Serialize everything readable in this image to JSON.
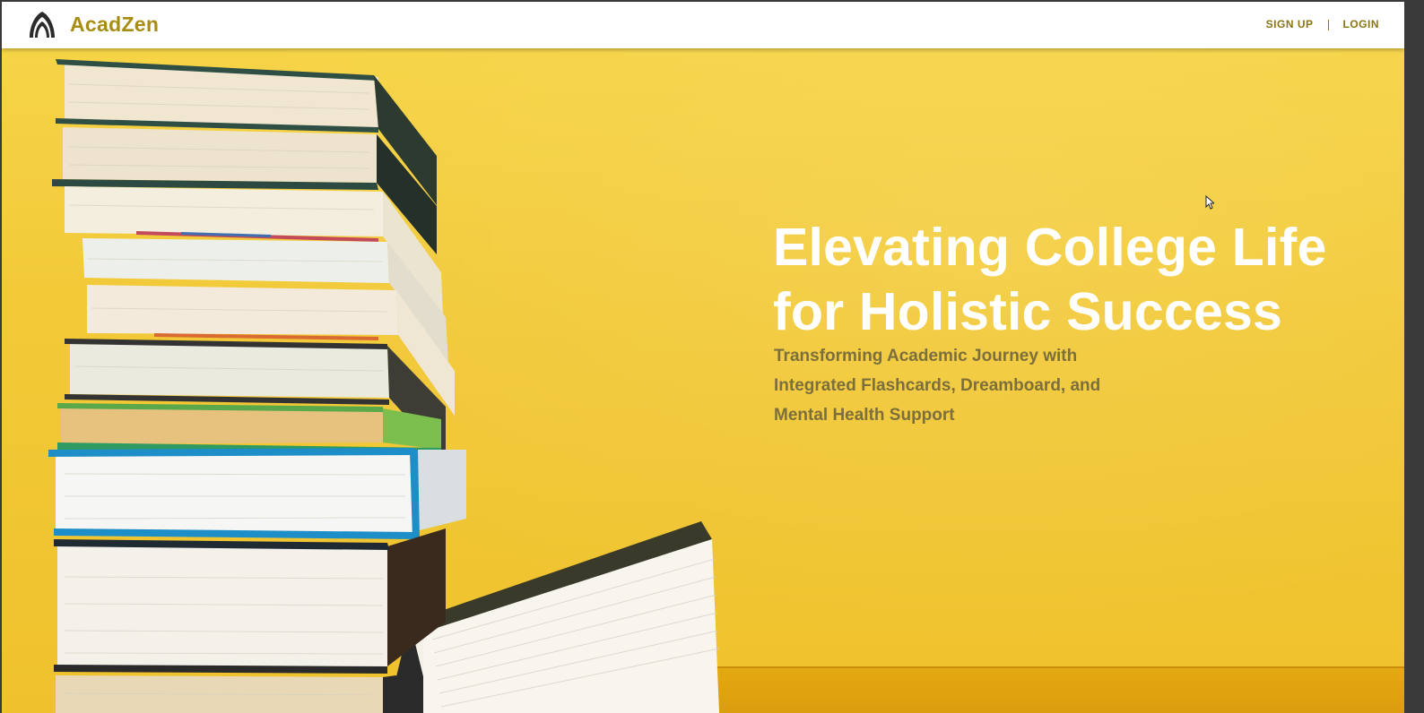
{
  "header": {
    "brand": "AcadZen",
    "logo_icon": "arch-logo-icon",
    "nav": {
      "signup_label": "SIGN UP",
      "login_label": "LOGIN"
    }
  },
  "hero": {
    "headline": "Elevating College Life for Holistic Success",
    "subline": "Transforming Academic Journey with Integrated Flashcards, Dreamboard, and Mental Health Support",
    "image": "stack-of-books-photo"
  },
  "colors": {
    "accent": "#a88d14",
    "hero_bg": "#f2c937",
    "headline": "#ffffff",
    "subline": "#7c6f3b"
  }
}
